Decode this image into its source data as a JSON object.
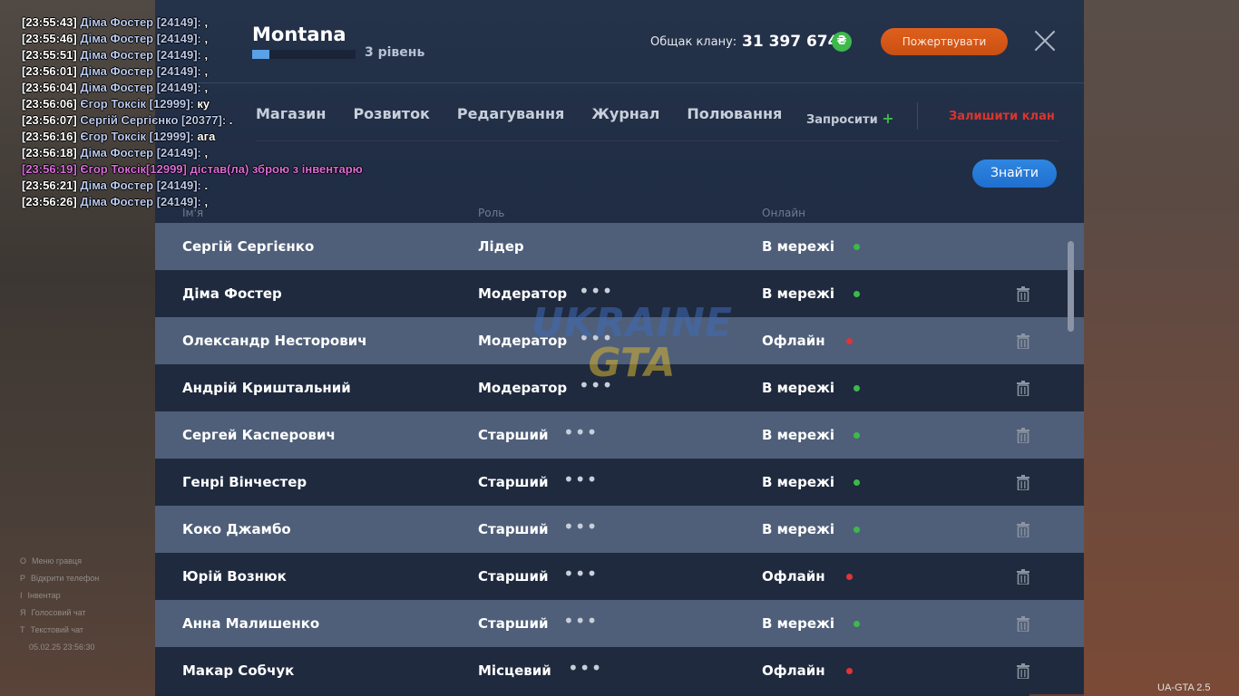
{
  "chat": [
    {
      "time": "[23:55:43]",
      "nick": "Діма Фостер [24149]:",
      "msg": " ,"
    },
    {
      "time": "[23:55:46]",
      "nick": "Діма Фостер [24149]:",
      "msg": " ,"
    },
    {
      "time": "[23:55:51]",
      "nick": "Діма Фостер [24149]:",
      "msg": " ,"
    },
    {
      "time": "[23:56:01]",
      "nick": "Діма Фостер [24149]:",
      "msg": " ,"
    },
    {
      "time": "[23:56:04]",
      "nick": "Діма Фостер [24149]:",
      "msg": " ,"
    },
    {
      "time": "[23:56:06]",
      "nick": "Єгор Токсік [12999]:",
      "msg": " ку"
    },
    {
      "time": "[23:56:07]",
      "nick": "Сергій Сергієнко [20377]:",
      "msg": " ."
    },
    {
      "time": "[23:56:16]",
      "nick": "Єгор Токсік [12999]:",
      "msg": " ага"
    },
    {
      "time": "[23:56:18]",
      "nick": "Діма Фостер [24149]:",
      "msg": " ,"
    },
    {
      "time": "[23:56:19]",
      "nick": "",
      "msg": " Єгор Токсік[12999] дістав(ла) зброю з інвентарю",
      "system": true
    },
    {
      "time": "[23:56:21]",
      "nick": "Діма Фостер [24149]:",
      "msg": " ."
    },
    {
      "time": "[23:56:26]",
      "nick": "Діма Фостер [24149]:",
      "msg": " ,"
    }
  ],
  "clan": {
    "name": "Montana",
    "level_text": "3 рівень",
    "level_progress": 0.17,
    "bank_label": "Общак клану:",
    "bank_value": "31 397 674",
    "coin_symbol": "₴",
    "donate_label": "Пожертвувати"
  },
  "tabs": [
    "Магазин",
    "Розвиток",
    "Редагування",
    "Журнал",
    "Полювання"
  ],
  "actions": {
    "invite_label": "Запросити",
    "invite_plus": "+",
    "leave_label": "Залишити клан",
    "find_label": "Знайти"
  },
  "columns": {
    "name": "Ім'я",
    "role": "Роль",
    "online": "Онлайн"
  },
  "members": [
    {
      "name": "Сергій Сергієнко",
      "role": "Лідер",
      "status": "В мережі",
      "online": true,
      "menu": false,
      "trash": false
    },
    {
      "name": "Діма Фостер",
      "role": "Модератор",
      "status": "В мережі",
      "online": true,
      "menu": true,
      "trash": true
    },
    {
      "name": "Олександр Несторович",
      "role": "Модератор",
      "status": "Офлайн",
      "online": false,
      "menu": true,
      "trash": true
    },
    {
      "name": "Андрій Криштальний",
      "role": "Модератор",
      "status": "В мережі",
      "online": true,
      "menu": true,
      "trash": true
    },
    {
      "name": "Сергей Касперович",
      "role": "Старший",
      "status": "В мережі",
      "online": true,
      "menu": true,
      "trash": true
    },
    {
      "name": "Генрі Вінчестер",
      "role": "Старший",
      "status": "В мережі",
      "online": true,
      "menu": true,
      "trash": true
    },
    {
      "name": "Коко Джамбо",
      "role": "Старший",
      "status": "В мережі",
      "online": true,
      "menu": true,
      "trash": true
    },
    {
      "name": "Юрій Вознюк",
      "role": "Старший",
      "status": "Офлайн",
      "online": false,
      "menu": true,
      "trash": true
    },
    {
      "name": "Анна Малишенко",
      "role": "Старший",
      "status": "В мережі",
      "online": true,
      "menu": true,
      "trash": true
    },
    {
      "name": "Макар Собчук",
      "role": "Місцевий",
      "status": "Офлайн",
      "online": false,
      "menu": true,
      "trash": true
    }
  ],
  "watermark": {
    "line1": "UKRAINE",
    "line2": "GTA"
  },
  "hud": {
    "left_menu": [
      "Меню гравця",
      "Відкрити телефон",
      "Інвентар",
      "Голосовий чат",
      "Текстовий чат"
    ],
    "left_keys": [
      "O",
      "P",
      "I",
      "Я",
      "T"
    ],
    "datetime": "05.02.25 23:56:30",
    "version": "UA-GTA 2.5"
  },
  "colors": {
    "online": "#3cb94a",
    "offline": "#e0343a",
    "accent": "#2f86e0",
    "donate": "#e0601c",
    "leave": "#d9352e"
  }
}
